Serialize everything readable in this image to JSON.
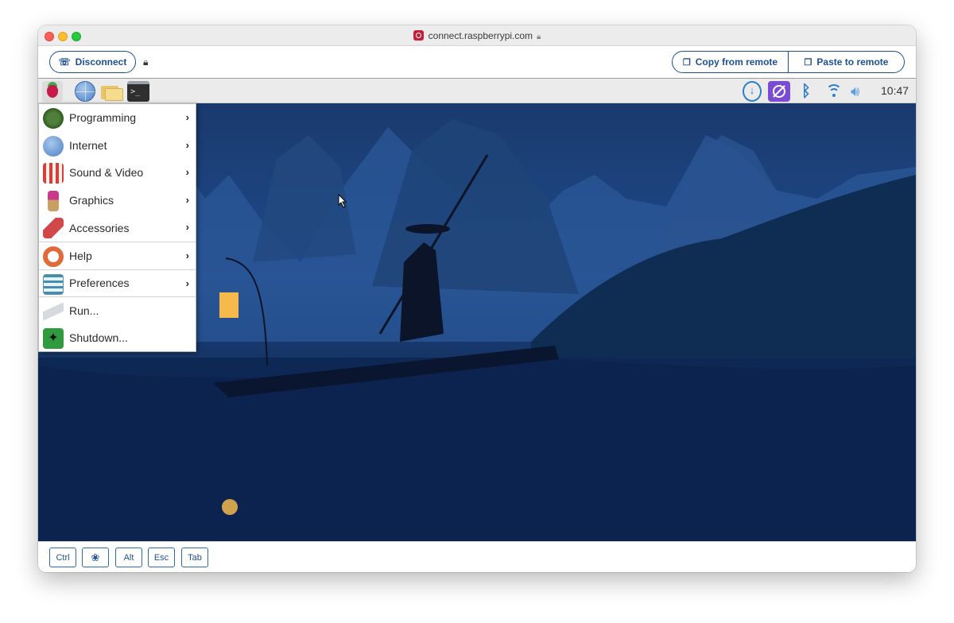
{
  "browser": {
    "address": "connect.raspberrypi.com"
  },
  "toolbar": {
    "disconnect_label": "Disconnect",
    "copy_label": "Copy from remote",
    "paste_label": "Paste to remote"
  },
  "taskbar": {
    "clock": "10:47",
    "launchers": [
      "raspberry-menu-icon",
      "web-browser-icon",
      "file-manager-icon",
      "terminal-icon"
    ],
    "tray": [
      "updater-icon",
      "connect-icon",
      "bluetooth-icon",
      "wifi-icon",
      "volume-icon"
    ]
  },
  "menu": {
    "items": [
      {
        "label": "Programming",
        "icon": "programming-icon",
        "submenu": true
      },
      {
        "label": "Internet",
        "icon": "internet-icon",
        "submenu": true
      },
      {
        "label": "Sound & Video",
        "icon": "sound-video-icon",
        "submenu": true
      },
      {
        "label": "Graphics",
        "icon": "graphics-icon",
        "submenu": true
      },
      {
        "label": "Accessories",
        "icon": "accessories-icon",
        "submenu": true
      },
      {
        "label": "Help",
        "icon": "help-icon",
        "submenu": true
      },
      {
        "label": "Preferences",
        "icon": "preferences-icon",
        "submenu": true
      },
      {
        "label": "Run...",
        "icon": "run-icon",
        "submenu": false
      },
      {
        "label": "Shutdown...",
        "icon": "shutdown-icon",
        "submenu": false
      }
    ]
  },
  "keys": {
    "ctrl": "Ctrl",
    "alt": "Alt",
    "esc": "Esc",
    "tab": "Tab"
  },
  "colors": {
    "accent": "#1e4f91",
    "menu_text": "#2a2a2a",
    "desktop": "#1f4a8c"
  }
}
